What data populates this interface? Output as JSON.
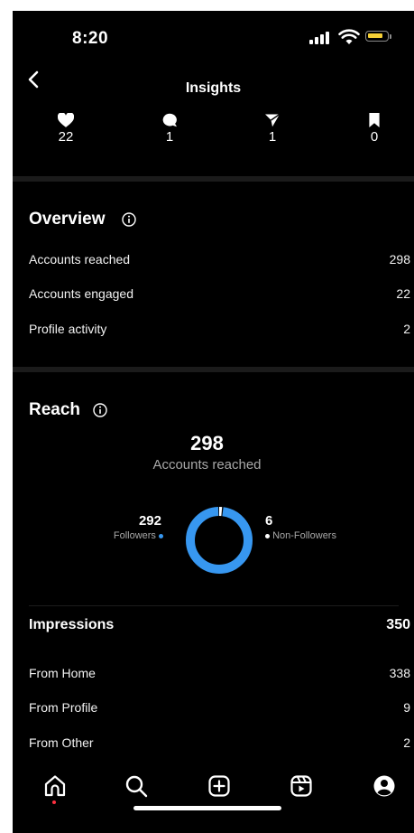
{
  "status": {
    "time": "8:20"
  },
  "header": {
    "title": "Insights"
  },
  "stats": [
    {
      "icon": "heart-icon",
      "value": "22"
    },
    {
      "icon": "comment-icon",
      "value": "1"
    },
    {
      "icon": "share-icon",
      "value": "1"
    },
    {
      "icon": "bookmark-icon",
      "value": "0"
    }
  ],
  "overview": {
    "title": "Overview",
    "rows": [
      {
        "label": "Accounts reached",
        "value": "298"
      },
      {
        "label": "Accounts engaged",
        "value": "22"
      },
      {
        "label": "Profile activity",
        "value": "2"
      }
    ]
  },
  "reach": {
    "title": "Reach",
    "total": "298",
    "total_label": "Accounts reached",
    "followers_value": "292",
    "followers_label": "Followers",
    "non_followers_value": "6",
    "non_followers_label": "Non-Followers",
    "followers_color": "#3797f0",
    "non_followers_color": "#ffffff"
  },
  "impressions": {
    "title": "Impressions",
    "value": "350",
    "rows": [
      {
        "label": "From Home",
        "value": "338"
      },
      {
        "label": "From Profile",
        "value": "9"
      },
      {
        "label": "From Other",
        "value": "2"
      }
    ]
  },
  "nav": {
    "items": [
      "home-icon",
      "search-icon",
      "create-icon",
      "reels-icon",
      "profile-icon"
    ],
    "active_dot_color": "#ff3040"
  }
}
